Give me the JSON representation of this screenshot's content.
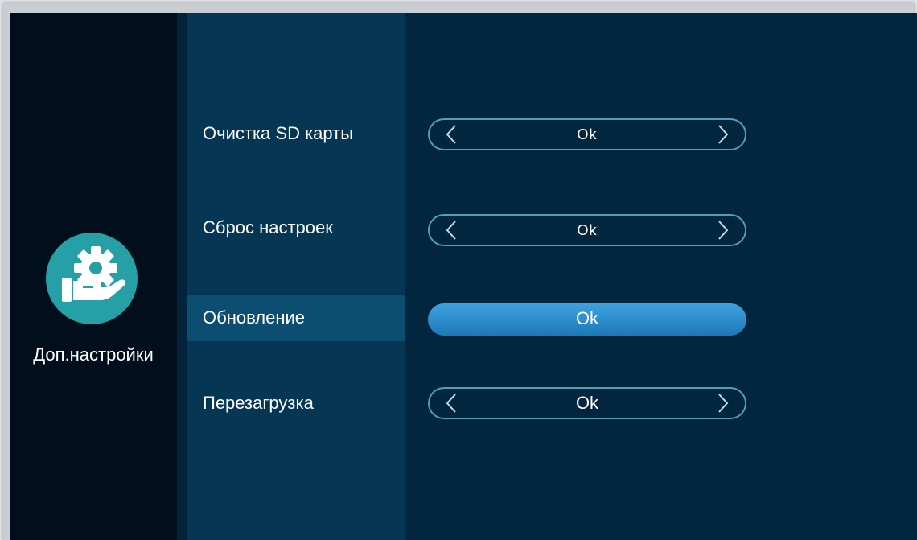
{
  "category": {
    "label": "Доп.настройки",
    "icon": "settings-hand-gear-icon",
    "icon_color": "#24a0a6"
  },
  "menu": {
    "items": [
      {
        "label": "Очистка SD карты",
        "value": "Ok",
        "selected": false
      },
      {
        "label": "Сброс настроек",
        "value": "Ok",
        "selected": false
      },
      {
        "label": "Обновление",
        "value": "Ok",
        "selected": true
      },
      {
        "label": "Перезагрузка",
        "value": "Ok",
        "selected": false
      }
    ]
  },
  "colors": {
    "background": "#03263f",
    "left_column": "#010e1b",
    "menu_column": "#053653",
    "selected_row": "#0b4e72",
    "selector_border": "#4f9fb9",
    "active_button": "#2f8fd0"
  }
}
